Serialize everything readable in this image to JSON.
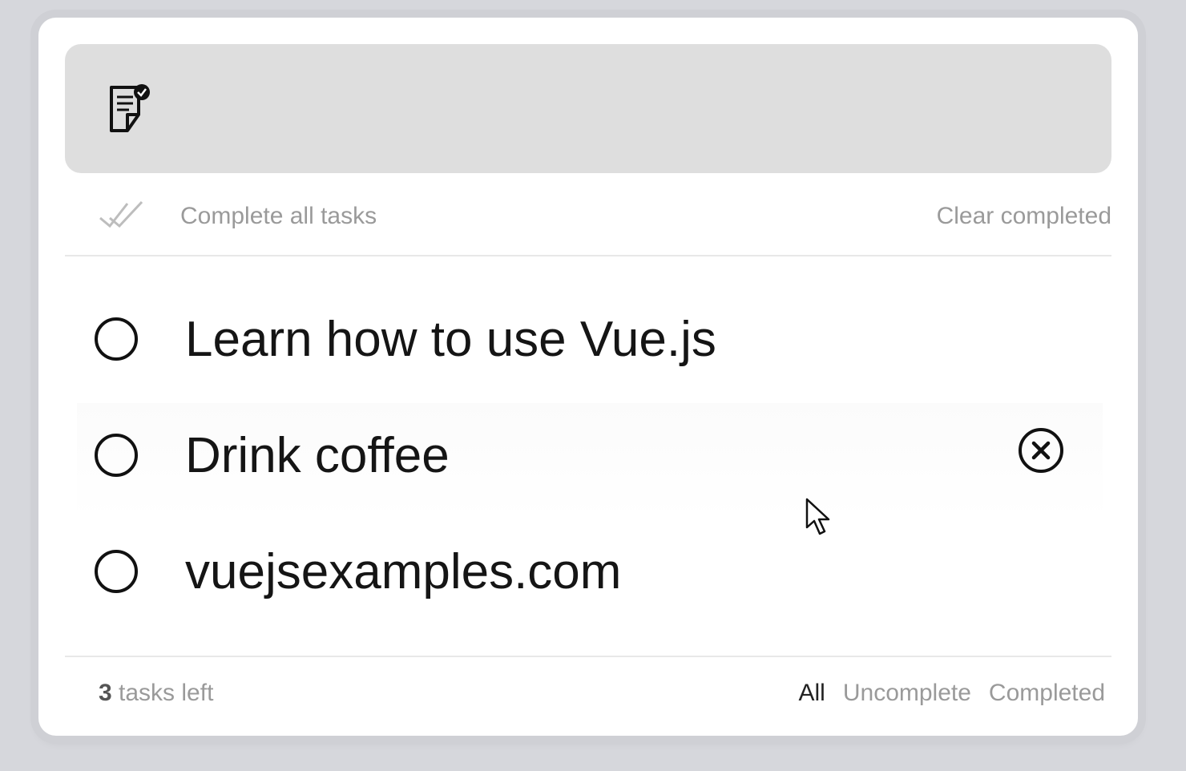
{
  "new_task": {
    "value": "",
    "placeholder": ""
  },
  "icons": {
    "input": "note-check-icon",
    "complete_all": "double-check-icon",
    "delete": "close-circle-icon",
    "cursor": "mouse-pointer-icon"
  },
  "toolbar": {
    "complete_all_label": "Complete all tasks",
    "clear_completed_label": "Clear completed"
  },
  "tasks": [
    {
      "text": "Learn how to use Vue.js",
      "completed": false
    },
    {
      "text": "Drink coffee",
      "completed": false,
      "hovered": true
    },
    {
      "text": "vuejsexamples.com",
      "completed": false
    }
  ],
  "footer": {
    "count": "3",
    "tasks_left_label": "tasks left",
    "filters": [
      {
        "label": "All",
        "active": true
      },
      {
        "label": "Uncomplete",
        "active": false
      },
      {
        "label": "Completed",
        "active": false
      }
    ]
  },
  "colors": {
    "background": "#d6d7dc",
    "card": "#ffffff",
    "input_bar": "#dedede",
    "muted_text": "#9a9a9a",
    "primary_text": "#151515"
  }
}
